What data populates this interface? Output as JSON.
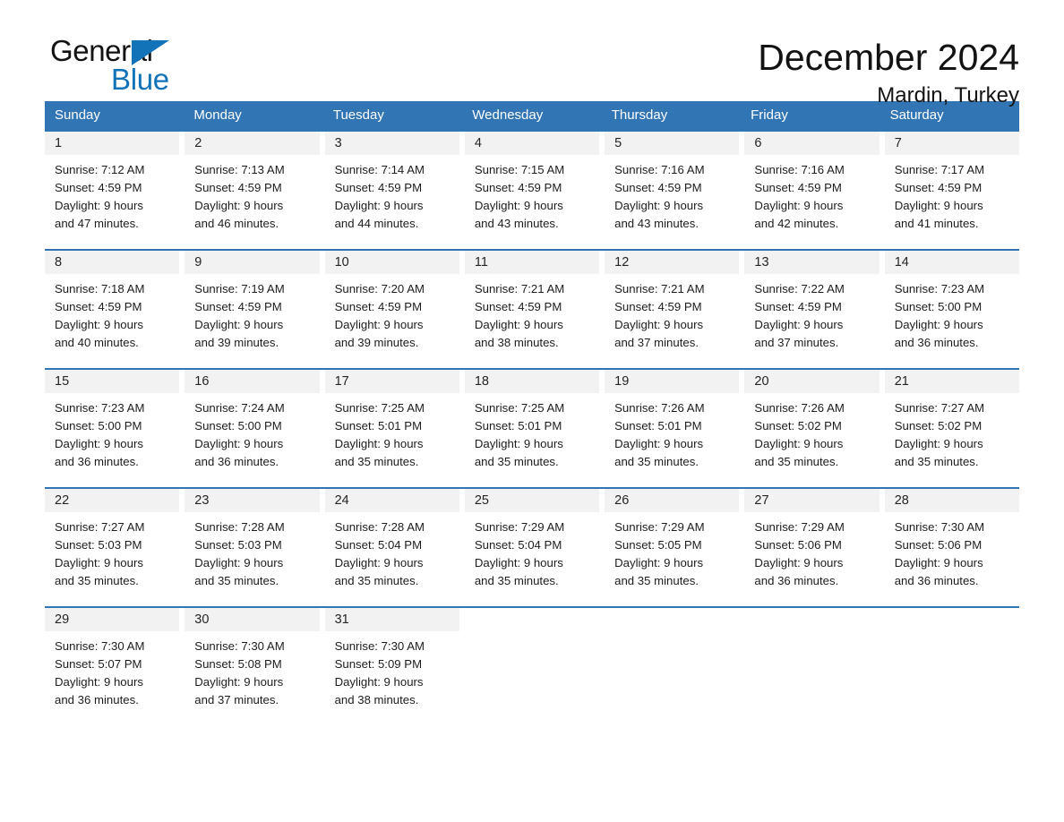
{
  "brand": {
    "name_part1": "General",
    "name_part2": "Blue",
    "accent_color": "#1273b8",
    "triangle_icon": "triangle-icon"
  },
  "header": {
    "title": "December 2024",
    "subtitle": "Mardin, Turkey"
  },
  "calendar": {
    "header_bg": "#3275b4",
    "daynum_bg": "#f2f2f2",
    "weekdays": [
      "Sunday",
      "Monday",
      "Tuesday",
      "Wednesday",
      "Thursday",
      "Friday",
      "Saturday"
    ],
    "weeks": [
      [
        {
          "day": "1",
          "sunrise": "Sunrise: 7:12 AM",
          "sunset": "Sunset: 4:59 PM",
          "daylight_line1": "Daylight: 9 hours",
          "daylight_line2": "and 47 minutes."
        },
        {
          "day": "2",
          "sunrise": "Sunrise: 7:13 AM",
          "sunset": "Sunset: 4:59 PM",
          "daylight_line1": "Daylight: 9 hours",
          "daylight_line2": "and 46 minutes."
        },
        {
          "day": "3",
          "sunrise": "Sunrise: 7:14 AM",
          "sunset": "Sunset: 4:59 PM",
          "daylight_line1": "Daylight: 9 hours",
          "daylight_line2": "and 44 minutes."
        },
        {
          "day": "4",
          "sunrise": "Sunrise: 7:15 AM",
          "sunset": "Sunset: 4:59 PM",
          "daylight_line1": "Daylight: 9 hours",
          "daylight_line2": "and 43 minutes."
        },
        {
          "day": "5",
          "sunrise": "Sunrise: 7:16 AM",
          "sunset": "Sunset: 4:59 PM",
          "daylight_line1": "Daylight: 9 hours",
          "daylight_line2": "and 43 minutes."
        },
        {
          "day": "6",
          "sunrise": "Sunrise: 7:16 AM",
          "sunset": "Sunset: 4:59 PM",
          "daylight_line1": "Daylight: 9 hours",
          "daylight_line2": "and 42 minutes."
        },
        {
          "day": "7",
          "sunrise": "Sunrise: 7:17 AM",
          "sunset": "Sunset: 4:59 PM",
          "daylight_line1": "Daylight: 9 hours",
          "daylight_line2": "and 41 minutes."
        }
      ],
      [
        {
          "day": "8",
          "sunrise": "Sunrise: 7:18 AM",
          "sunset": "Sunset: 4:59 PM",
          "daylight_line1": "Daylight: 9 hours",
          "daylight_line2": "and 40 minutes."
        },
        {
          "day": "9",
          "sunrise": "Sunrise: 7:19 AM",
          "sunset": "Sunset: 4:59 PM",
          "daylight_line1": "Daylight: 9 hours",
          "daylight_line2": "and 39 minutes."
        },
        {
          "day": "10",
          "sunrise": "Sunrise: 7:20 AM",
          "sunset": "Sunset: 4:59 PM",
          "daylight_line1": "Daylight: 9 hours",
          "daylight_line2": "and 39 minutes."
        },
        {
          "day": "11",
          "sunrise": "Sunrise: 7:21 AM",
          "sunset": "Sunset: 4:59 PM",
          "daylight_line1": "Daylight: 9 hours",
          "daylight_line2": "and 38 minutes."
        },
        {
          "day": "12",
          "sunrise": "Sunrise: 7:21 AM",
          "sunset": "Sunset: 4:59 PM",
          "daylight_line1": "Daylight: 9 hours",
          "daylight_line2": "and 37 minutes."
        },
        {
          "day": "13",
          "sunrise": "Sunrise: 7:22 AM",
          "sunset": "Sunset: 4:59 PM",
          "daylight_line1": "Daylight: 9 hours",
          "daylight_line2": "and 37 minutes."
        },
        {
          "day": "14",
          "sunrise": "Sunrise: 7:23 AM",
          "sunset": "Sunset: 5:00 PM",
          "daylight_line1": "Daylight: 9 hours",
          "daylight_line2": "and 36 minutes."
        }
      ],
      [
        {
          "day": "15",
          "sunrise": "Sunrise: 7:23 AM",
          "sunset": "Sunset: 5:00 PM",
          "daylight_line1": "Daylight: 9 hours",
          "daylight_line2": "and 36 minutes."
        },
        {
          "day": "16",
          "sunrise": "Sunrise: 7:24 AM",
          "sunset": "Sunset: 5:00 PM",
          "daylight_line1": "Daylight: 9 hours",
          "daylight_line2": "and 36 minutes."
        },
        {
          "day": "17",
          "sunrise": "Sunrise: 7:25 AM",
          "sunset": "Sunset: 5:01 PM",
          "daylight_line1": "Daylight: 9 hours",
          "daylight_line2": "and 35 minutes."
        },
        {
          "day": "18",
          "sunrise": "Sunrise: 7:25 AM",
          "sunset": "Sunset: 5:01 PM",
          "daylight_line1": "Daylight: 9 hours",
          "daylight_line2": "and 35 minutes."
        },
        {
          "day": "19",
          "sunrise": "Sunrise: 7:26 AM",
          "sunset": "Sunset: 5:01 PM",
          "daylight_line1": "Daylight: 9 hours",
          "daylight_line2": "and 35 minutes."
        },
        {
          "day": "20",
          "sunrise": "Sunrise: 7:26 AM",
          "sunset": "Sunset: 5:02 PM",
          "daylight_line1": "Daylight: 9 hours",
          "daylight_line2": "and 35 minutes."
        },
        {
          "day": "21",
          "sunrise": "Sunrise: 7:27 AM",
          "sunset": "Sunset: 5:02 PM",
          "daylight_line1": "Daylight: 9 hours",
          "daylight_line2": "and 35 minutes."
        }
      ],
      [
        {
          "day": "22",
          "sunrise": "Sunrise: 7:27 AM",
          "sunset": "Sunset: 5:03 PM",
          "daylight_line1": "Daylight: 9 hours",
          "daylight_line2": "and 35 minutes."
        },
        {
          "day": "23",
          "sunrise": "Sunrise: 7:28 AM",
          "sunset": "Sunset: 5:03 PM",
          "daylight_line1": "Daylight: 9 hours",
          "daylight_line2": "and 35 minutes."
        },
        {
          "day": "24",
          "sunrise": "Sunrise: 7:28 AM",
          "sunset": "Sunset: 5:04 PM",
          "daylight_line1": "Daylight: 9 hours",
          "daylight_line2": "and 35 minutes."
        },
        {
          "day": "25",
          "sunrise": "Sunrise: 7:29 AM",
          "sunset": "Sunset: 5:04 PM",
          "daylight_line1": "Daylight: 9 hours",
          "daylight_line2": "and 35 minutes."
        },
        {
          "day": "26",
          "sunrise": "Sunrise: 7:29 AM",
          "sunset": "Sunset: 5:05 PM",
          "daylight_line1": "Daylight: 9 hours",
          "daylight_line2": "and 35 minutes."
        },
        {
          "day": "27",
          "sunrise": "Sunrise: 7:29 AM",
          "sunset": "Sunset: 5:06 PM",
          "daylight_line1": "Daylight: 9 hours",
          "daylight_line2": "and 36 minutes."
        },
        {
          "day": "28",
          "sunrise": "Sunrise: 7:30 AM",
          "sunset": "Sunset: 5:06 PM",
          "daylight_line1": "Daylight: 9 hours",
          "daylight_line2": "and 36 minutes."
        }
      ],
      [
        {
          "day": "29",
          "sunrise": "Sunrise: 7:30 AM",
          "sunset": "Sunset: 5:07 PM",
          "daylight_line1": "Daylight: 9 hours",
          "daylight_line2": "and 36 minutes."
        },
        {
          "day": "30",
          "sunrise": "Sunrise: 7:30 AM",
          "sunset": "Sunset: 5:08 PM",
          "daylight_line1": "Daylight: 9 hours",
          "daylight_line2": "and 37 minutes."
        },
        {
          "day": "31",
          "sunrise": "Sunrise: 7:30 AM",
          "sunset": "Sunset: 5:09 PM",
          "daylight_line1": "Daylight: 9 hours",
          "daylight_line2": "and 38 minutes."
        },
        {
          "day": "",
          "sunrise": "",
          "sunset": "",
          "daylight_line1": "",
          "daylight_line2": ""
        },
        {
          "day": "",
          "sunrise": "",
          "sunset": "",
          "daylight_line1": "",
          "daylight_line2": ""
        },
        {
          "day": "",
          "sunrise": "",
          "sunset": "",
          "daylight_line1": "",
          "daylight_line2": ""
        },
        {
          "day": "",
          "sunrise": "",
          "sunset": "",
          "daylight_line1": "",
          "daylight_line2": ""
        }
      ]
    ]
  }
}
